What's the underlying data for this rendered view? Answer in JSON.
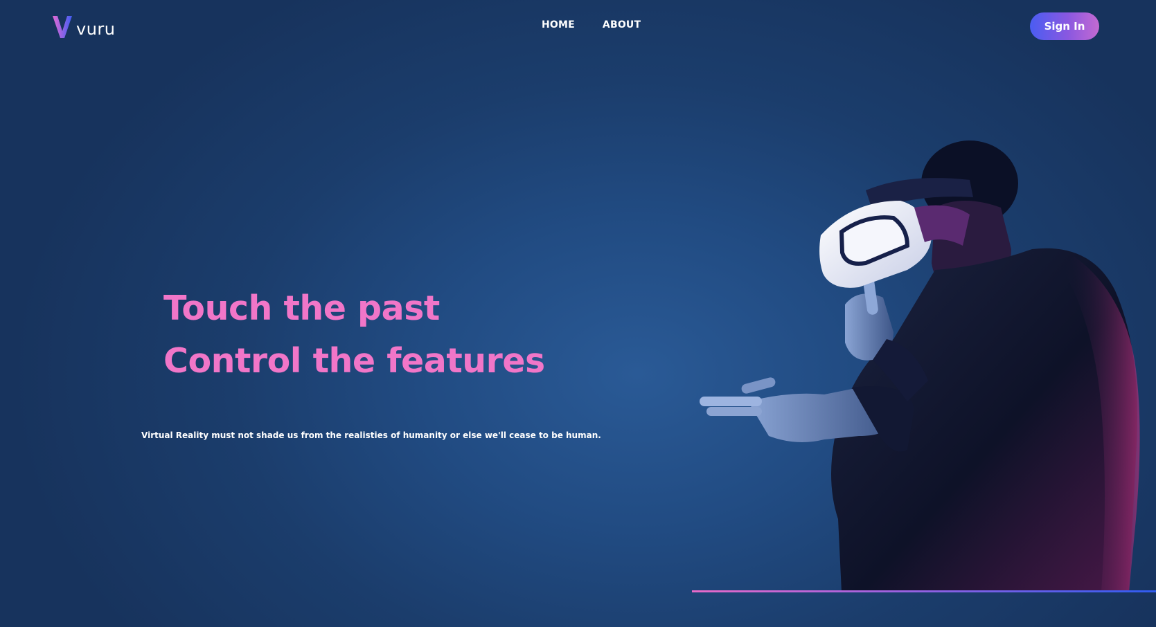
{
  "brand": {
    "name": "vuru",
    "mark_letter": "V",
    "colors": {
      "mark_start": "#e36ad4",
      "mark_end": "#3f5df5"
    }
  },
  "nav": {
    "items": [
      {
        "label": "HOME"
      },
      {
        "label": "ABOUT"
      }
    ]
  },
  "header": {
    "signin_label": "Sign In"
  },
  "hero": {
    "headline_line1": "Touch the past",
    "headline_line2": "Control the features",
    "subtitle": "Virtual Reality must not shade us from the realisties of humanity or else we'll cease to be human.",
    "image": "vr-headset-person-icon"
  },
  "colors": {
    "background": "#1f467c",
    "headline": "#f176c8",
    "button_gradient_start": "#4a5df2",
    "button_gradient_end": "#c46ad2",
    "baseline_start": "#e86ac8",
    "baseline_end": "#2f5cf0"
  }
}
